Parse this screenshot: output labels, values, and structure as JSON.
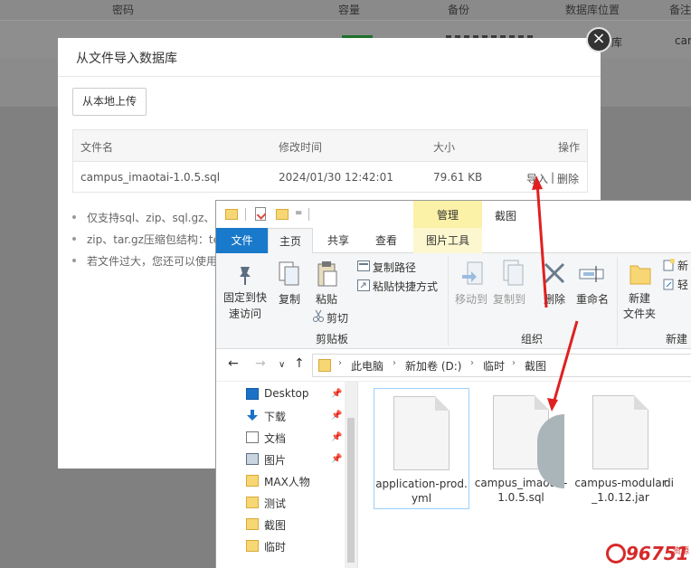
{
  "background_table": {
    "headers": [
      "密码",
      "容量",
      "备份",
      "数据库位置",
      "备注"
    ],
    "row": {
      "location": "库",
      "note": "cam"
    }
  },
  "dialog": {
    "title": "从文件导入数据库",
    "close_icon": "close-icon",
    "upload_label": "从本地上传",
    "table": {
      "columns": [
        "文件名",
        "修改时间",
        "大小",
        "操作"
      ],
      "rows": [
        {
          "name": "campus_imaotai-1.0.5.sql",
          "time": "2024/01/30 12:42:01",
          "size": "79.61 KB",
          "import": "导入",
          "sep": "|",
          "delete": "删除"
        }
      ]
    },
    "notes": [
      "仅支持sql、zip、sql.gz、(",
      "zip、tar.gz压缩包结构：te",
      "若文件过大，您还可以使用"
    ]
  },
  "explorer": {
    "qat_dropdown": "=",
    "context_group": "管理",
    "context_title": "截图",
    "tabs": {
      "file": "文件",
      "home": "主页",
      "share": "共享",
      "view": "查看",
      "pictools": "图片工具"
    },
    "ribbon": {
      "pin": "固定到快\n速访问",
      "copy": "复制",
      "paste": "粘贴",
      "copy_path": "复制路径",
      "paste_shortcut": "粘贴快捷方式",
      "cut": "剪切",
      "clipboard": "剪贴板",
      "move_to": "移动到",
      "copy_to": "复制到",
      "delete": "删除",
      "rename": "重命名",
      "organize": "组织",
      "new_folder": "新建\n文件夹",
      "new_item": "新",
      "easy_access": "轻",
      "new_group": "新建"
    },
    "address": {
      "back": "←",
      "forward": "→",
      "recent": "∨",
      "up": "↑",
      "crumbs": [
        "此电脑",
        "新加卷 (D:)",
        "临时",
        "截图"
      ]
    },
    "nav": [
      {
        "label": "Desktop",
        "pinned": true
      },
      {
        "label": "下载",
        "pinned": true
      },
      {
        "label": "文档",
        "pinned": true
      },
      {
        "label": "图片",
        "pinned": true
      },
      {
        "label": "MAX人物",
        "pinned": false
      },
      {
        "label": "测试",
        "pinned": false
      },
      {
        "label": "截图",
        "pinned": false
      },
      {
        "label": "临时",
        "pinned": false
      }
    ],
    "files": [
      {
        "name": "application-prod.yml"
      },
      {
        "name": "campus_imaotai-1.0.5.sql"
      },
      {
        "name": "campus-modular_1.0.12.jar"
      },
      {
        "name": "di"
      }
    ]
  },
  "watermark": {
    "text": "96751",
    "sub": "资源"
  },
  "colors": {
    "accent_blue": "#1979ca",
    "green": "#20a53a",
    "arrow_red": "#e02020",
    "context_yellow": "#fbf1a7"
  }
}
